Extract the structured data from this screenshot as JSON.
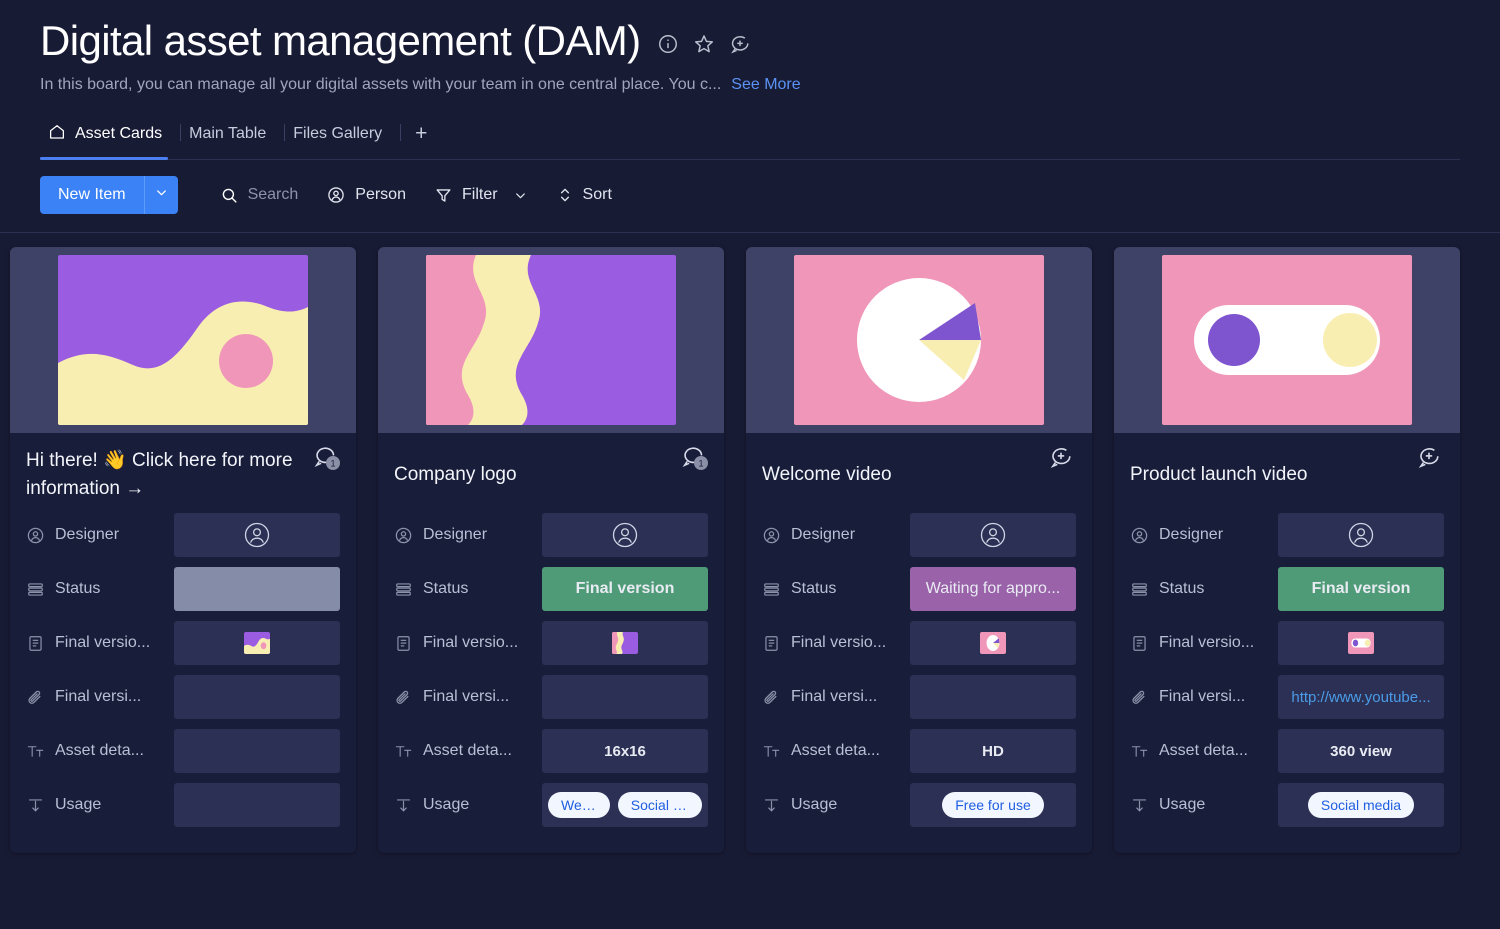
{
  "header": {
    "title": "Digital asset management (DAM)",
    "description": "In this board, you can manage all your digital assets with your team in one central place. You c...",
    "see_more": "See More",
    "icons": [
      "info-icon",
      "star-icon",
      "add-comment-icon"
    ]
  },
  "tabs": {
    "items": [
      {
        "label": "Asset Cards",
        "icon": "home-icon",
        "active": true
      },
      {
        "label": "Main Table",
        "icon": "",
        "active": false
      },
      {
        "label": "Files Gallery",
        "icon": "",
        "active": false
      }
    ],
    "add_label": "+"
  },
  "toolbar": {
    "new_item_label": "New Item",
    "new_item_caret": "chevron-down-icon",
    "search_label": "Search",
    "person_label": "Person",
    "filter_label": "Filter",
    "sort_label": "Sort"
  },
  "row_labels": {
    "designer": "Designer",
    "status": "Status",
    "final_version_file": "Final versio...",
    "final_version_link": "Final versi...",
    "asset_details": "Asset deta...",
    "usage": "Usage"
  },
  "colors": {
    "accent_blue": "#3b82f6",
    "status_green": "#4f9b77",
    "status_purple": "#9a62a8",
    "status_empty": "#848ca8",
    "art_purple": "#9a5ce0",
    "art_cream": "#f9eeb2",
    "art_pink": "#f097b9",
    "tag_text": "#1f5fe0",
    "link_text": "#4a9ce8"
  },
  "cards": [
    {
      "id": "card-welcome",
      "title": "Hi there!  👋 Click here for more information  →",
      "two_line": true,
      "badge": {
        "type": "comment-count-icon",
        "count": "1"
      },
      "art": "wave",
      "designer": "",
      "status": {
        "text": "",
        "style": "empty-grey"
      },
      "file": {
        "has_thumb": false,
        "art": "wave"
      },
      "link": "",
      "asset_details": "",
      "usage": []
    },
    {
      "id": "card-company-logo",
      "title": "Company logo",
      "two_line": false,
      "badge": {
        "type": "comment-count-icon",
        "count": "1"
      },
      "art": "stripes",
      "designer": "",
      "status": {
        "text": "Final version",
        "style": "status-green"
      },
      "file": {
        "has_thumb": true,
        "art": "stripes"
      },
      "link": "",
      "asset_details": "16x16",
      "usage": [
        "Web...",
        "Social m..."
      ]
    },
    {
      "id": "card-welcome-video",
      "title": "Welcome video",
      "two_line": false,
      "badge": {
        "type": "add-comment-icon",
        "count": ""
      },
      "art": "pie",
      "designer": "",
      "status": {
        "text": "Waiting for appro...",
        "style": "status-purple"
      },
      "file": {
        "has_thumb": true,
        "art": "pie"
      },
      "link": "",
      "asset_details": "HD",
      "usage": [
        "Free for use"
      ]
    },
    {
      "id": "card-product-launch-video",
      "title": "Product launch video",
      "two_line": false,
      "badge": {
        "type": "add-comment-icon",
        "count": ""
      },
      "art": "toggle",
      "designer": "",
      "status": {
        "text": "Final version",
        "style": "status-green"
      },
      "file": {
        "has_thumb": true,
        "art": "toggle"
      },
      "link": "http://www.youtube...",
      "asset_details": "360 view",
      "usage": [
        "Social media"
      ]
    }
  ]
}
